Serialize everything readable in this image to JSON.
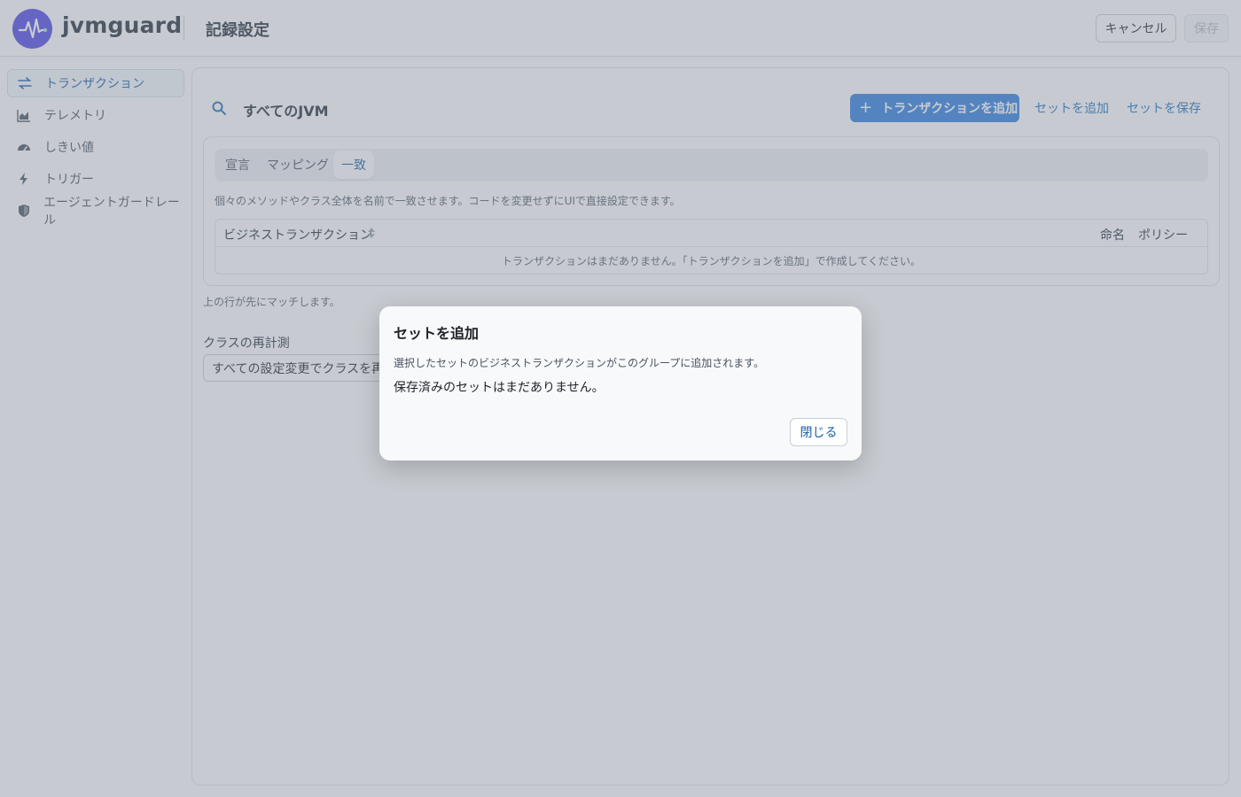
{
  "header": {
    "brand": "jvmguard",
    "page_title": "記録設定",
    "cancel_label": "キャンセル",
    "save_label": "保存"
  },
  "sidebar": {
    "items": [
      {
        "label": "トランザクション",
        "icon": "transactions-icon",
        "active": true
      },
      {
        "label": "テレメトリ",
        "icon": "area-chart-icon",
        "active": false
      },
      {
        "label": "しきい値",
        "icon": "gauge-icon",
        "active": false
      },
      {
        "label": "トリガー",
        "icon": "bolt-icon",
        "active": false
      },
      {
        "label": "エージェントガードレール",
        "icon": "shield-icon",
        "active": false
      }
    ]
  },
  "main": {
    "scope_title": "すべてのJVM",
    "add_transaction_label": "トランザクションを追加",
    "add_set_label": "セットを追加",
    "save_set_label": "セットを保存",
    "tabs": [
      {
        "label": "宣言",
        "active": false
      },
      {
        "label": "マッピング",
        "active": false
      },
      {
        "label": "一致",
        "active": true
      }
    ],
    "description": "個々のメソッドやクラス全体を名前で一致させます。コードを変更せずにUIで直接設定できます。",
    "table": {
      "columns": [
        "ビジネストランザクション",
        "命名",
        "ポリシー"
      ],
      "empty_text": "トランザクションはまだありません。「トランザクションを追加」で作成してください。"
    },
    "order_hint": "上の行が先にマッチします。",
    "reinstrument": {
      "label": "クラスの再計測",
      "value": "すべての設定変更でクラスを再変換"
    }
  },
  "modal": {
    "title": "セットを追加",
    "description": "選択したセットのビジネストランザクションがこのグループに追加されます。",
    "empty_text": "保存済みのセットはまだありません。",
    "close_label": "閉じる"
  },
  "colors": {
    "accent": "#2f7fe0",
    "brand": "#4f46e5",
    "link": "#1d6fc0"
  }
}
